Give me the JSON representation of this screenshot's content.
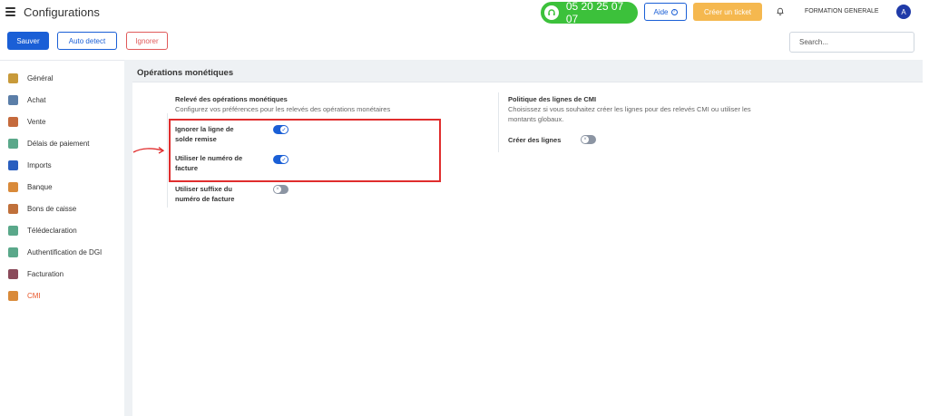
{
  "header": {
    "title": "Configurations",
    "phone": "05 20 25 07 07",
    "help_label": "Aide",
    "ticket_label": "Créer un ticket",
    "user_name": "FORMATION GENERALE",
    "avatar_letter": "A"
  },
  "toolbar": {
    "save_label": "Sauver",
    "auto_detect_label": "Auto detect",
    "ignore_label": "Ignorer",
    "search_placeholder": "Search..."
  },
  "sidebar": {
    "items": [
      {
        "label": "Général",
        "icon": "gear-icon",
        "color": "#c89a3a"
      },
      {
        "label": "Achat",
        "icon": "cash-register-icon",
        "color": "#5b7ea8"
      },
      {
        "label": "Vente",
        "icon": "chart-icon",
        "color": "#c56a3c"
      },
      {
        "label": "Délais de paiement",
        "icon": "calendar-icon",
        "color": "#5aa88a"
      },
      {
        "label": "Imports",
        "icon": "folder-icon",
        "color": "#2a5fbf"
      },
      {
        "label": "Banque",
        "icon": "coin-icon",
        "color": "#d98a3a"
      },
      {
        "label": "Bons de caisse",
        "icon": "receipt-icon",
        "color": "#c0703a"
      },
      {
        "label": "Télédeclaration",
        "icon": "document-icon",
        "color": "#5aa88a"
      },
      {
        "label": "Authentification de DGI",
        "icon": "document-icon",
        "color": "#5aa88a"
      },
      {
        "label": "Facturation",
        "icon": "tag-icon",
        "color": "#8a4a5a"
      },
      {
        "label": "CMI",
        "icon": "coin-icon",
        "color": "#d98a3a",
        "active": true
      }
    ]
  },
  "section": {
    "title": "Opérations monétiques"
  },
  "left_group": {
    "title": "Relevé des opérations monétiques",
    "description": "Configurez vos préférences pour les relevés des opérations monétaires",
    "options": [
      {
        "label_line1": "Ignorer la ligne de",
        "label_line2": "solde remise",
        "enabled": true
      },
      {
        "label_line1": "Utiliser le numéro de",
        "label_line2": "facture",
        "enabled": true
      },
      {
        "label_line1": "Utiliser suffixe du",
        "label_line2": "numéro de facture",
        "enabled": false
      }
    ]
  },
  "right_group": {
    "title": "Politique des lignes de CMI",
    "description_line1": "Choisissez si vous souhaitez créer les lignes pour des relevés CMI ou utiliser les",
    "description_line2": "montants globaux.",
    "options": [
      {
        "label": "Créer des lignes",
        "enabled": false
      }
    ]
  },
  "colors": {
    "primary": "#1a5fd6",
    "phone_green": "#3cc13b",
    "ticket_orange": "#f5b84f",
    "danger": "#e05a5a",
    "highlight_red": "#e02d2d",
    "active_orange": "#e8572a"
  }
}
